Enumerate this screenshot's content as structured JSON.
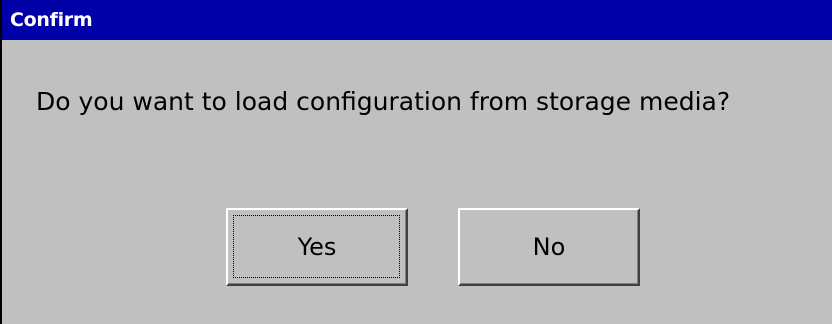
{
  "dialog": {
    "title": "Confirm",
    "message": "Do you want to load configuration from storage media?",
    "buttons": {
      "yes_label": "Yes",
      "no_label": "No",
      "focused": "Yes"
    }
  },
  "colors": {
    "title_bar": "#0000a8",
    "title_text": "#ffffff",
    "dialog_background": "#c0c0c0",
    "text": "#000000"
  }
}
